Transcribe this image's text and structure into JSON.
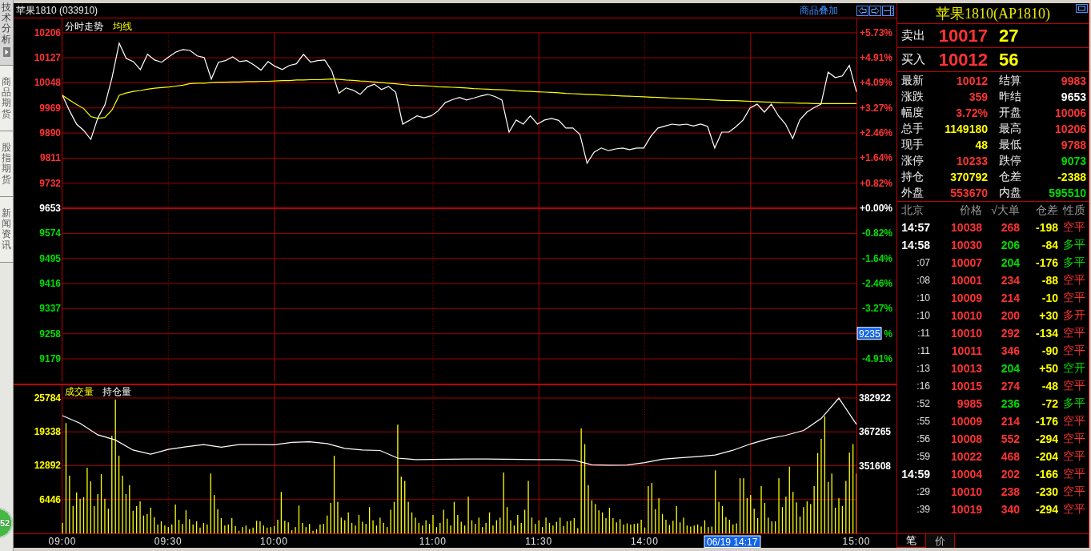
{
  "side_tabs": [
    {
      "label": "技术分析",
      "selected": true
    },
    {
      "label": "商品期货",
      "selected": false
    },
    {
      "label": "股指期货",
      "selected": false
    },
    {
      "label": "新闻资讯",
      "selected": false
    }
  ],
  "header": {
    "title": "苹果1810 (033910)",
    "overlay_link": "商品叠加"
  },
  "price_panel": {
    "chart_data": {
      "type": "line",
      "categories": [
        null,
        null,
        null,
        null,
        null,
        null,
        null,
        null,
        null,
        null,
        null,
        null,
        null,
        null,
        null,
        null,
        null,
        null,
        null,
        null,
        null,
        null,
        null,
        null,
        null,
        null,
        null,
        null,
        null,
        null,
        null,
        null,
        null,
        null,
        null,
        null,
        null,
        null,
        null,
        null,
        null,
        null,
        null,
        null,
        null,
        null,
        null,
        null,
        null,
        null,
        null,
        null,
        null,
        null,
        null,
        null,
        null,
        null,
        null,
        null,
        null,
        null,
        null,
        null,
        null,
        null,
        null,
        null,
        null,
        null,
        null,
        null,
        null,
        null,
        null,
        null,
        null,
        null,
        null,
        null,
        null,
        null,
        null,
        null,
        null,
        null,
        null,
        null,
        null,
        null,
        null,
        null,
        null,
        null,
        null,
        null,
        null,
        null,
        null,
        null,
        null,
        null,
        null,
        null,
        null,
        null,
        null,
        null,
        null,
        null,
        null,
        null,
        null
      ],
      "series": [
        {
          "name": "分时走势",
          "color": "#ffffff",
          "values": [
            10009,
            9960,
            9918,
            9898,
            9870,
            9938,
            9979,
            10065,
            10173,
            10125,
            10115,
            10090,
            10138,
            10120,
            10113,
            10130,
            10145,
            10153,
            10150,
            10133,
            10128,
            10060,
            10113,
            10118,
            10130,
            10115,
            10118,
            10105,
            10088,
            10115,
            10100,
            10090,
            10103,
            10108,
            10138,
            10113,
            10118,
            10120,
            10085,
            10015,
            10032,
            10025,
            10012,
            10035,
            10044,
            10027,
            10037,
            10019,
            9918,
            9931,
            9944,
            9938,
            9944,
            9960,
            9986,
            9995,
            10002,
            9994,
            10000,
            10007,
            10012,
            10005,
            9994,
            9893,
            9931,
            9918,
            9944,
            9918,
            9931,
            9936,
            9930,
            9906,
            9906,
            9885,
            9795,
            9830,
            9843,
            9835,
            9840,
            9843,
            9838,
            9843,
            9843,
            9880,
            9906,
            9912,
            9918,
            9915,
            9918,
            9912,
            9918,
            9911,
            9843,
            9893,
            9893,
            9910,
            9931,
            9969,
            9981,
            9956,
            9981,
            9944,
            9918,
            9873,
            9931,
            9956,
            9970,
            9981,
            10082,
            10065,
            10070,
            10103,
            10020
          ]
        },
        {
          "name": "均线",
          "color": "#ffff00",
          "values": [
            10009,
            9994,
            9980,
            9967,
            9942,
            9936,
            9939,
            9963,
            10009,
            10016,
            10021,
            10024,
            10028,
            10031,
            10033,
            10035,
            10038,
            10041,
            10046,
            10047,
            10047,
            10049,
            10050,
            10050,
            10051,
            10051,
            10052,
            10052,
            10053,
            10053,
            10054,
            10055,
            10055,
            10057,
            10057,
            10058,
            10058,
            10059,
            10060,
            10059,
            10057,
            10056,
            10054,
            10053,
            10051,
            10049,
            10047,
            10045,
            10043,
            10041,
            10040,
            10039,
            10038,
            10036,
            10035,
            10034,
            10033,
            10032,
            10030,
            10029,
            10028,
            10027,
            10026,
            10025,
            10023,
            10022,
            10021,
            10020,
            10019,
            10018,
            10017,
            10015,
            10014,
            10013,
            10012,
            10011,
            10010,
            10009,
            10008,
            10007,
            10006,
            10005,
            10004,
            10003,
            10002,
            10001,
            10000,
            9999,
            9998,
            9997,
            9996,
            9995,
            9994,
            9993,
            9992,
            9992,
            9991,
            9990,
            9989,
            9988,
            9987,
            9986,
            9985,
            9985,
            9984,
            9984,
            9983,
            9983,
            9983,
            9983,
            9983,
            9983,
            9983
          ]
        }
      ],
      "ylim": [
        9101,
        10251
      ],
      "yticks": [
        10206,
        10127,
        10048,
        9969,
        9890,
        9811,
        9732,
        9653,
        9574,
        9495,
        9416,
        9337,
        9258,
        9179
      ],
      "ref_lines": [
        {
          "axis": "y",
          "value": 9653
        }
      ],
      "grid": true
    },
    "percent_labels": [
      {
        "text": "+5.73%"
      },
      {
        "text": "+4.91%"
      },
      {
        "text": "+4.09%"
      },
      {
        "text": "+3.27%"
      },
      {
        "text": "+2.46%"
      },
      {
        "text": "+1.64%"
      },
      {
        "text": "+0.82%"
      },
      {
        "text": "+0.00%"
      },
      {
        "text": "-0.82%"
      },
      {
        "text": "-1.64%"
      },
      {
        "text": "-2.46%"
      },
      {
        "text": "-3.27%"
      },
      {
        "text": "%",
        "cursor": "9235"
      },
      {
        "text": "-4.91%"
      }
    ]
  },
  "volume_panel": {
    "chart_data": {
      "type": "bar",
      "categories": [
        "09:00",
        null,
        null,
        null,
        null,
        null,
        null,
        null,
        null,
        null,
        null,
        null,
        null,
        null,
        null,
        null,
        null,
        null,
        null,
        null,
        null,
        null,
        null,
        null,
        null,
        null,
        null,
        null,
        null,
        null,
        "09:30",
        null,
        null,
        null,
        null,
        null,
        null,
        null,
        null,
        null,
        null,
        null,
        null,
        null,
        null,
        null,
        null,
        null,
        null,
        null,
        null,
        null,
        null,
        null,
        null,
        null,
        null,
        null,
        null,
        null,
        "10:00",
        null,
        null,
        null,
        null,
        null,
        null,
        null,
        null,
        null,
        null,
        null,
        null,
        null,
        null,
        null,
        null,
        null,
        null,
        null,
        null,
        null,
        null,
        null,
        null,
        null,
        null,
        null,
        null,
        null,
        null,
        null,
        null,
        null,
        null,
        null,
        null,
        null,
        null,
        null,
        null,
        null,
        null,
        null,
        null,
        "11:00",
        null,
        null,
        null,
        null,
        null,
        null,
        null,
        null,
        null,
        null,
        null,
        null,
        null,
        null,
        null,
        null,
        null,
        null,
        null,
        null,
        null,
        null,
        null,
        null,
        null,
        null,
        null,
        null,
        null,
        "11:30",
        null,
        null,
        null,
        null,
        null,
        null,
        null,
        null,
        null,
        null,
        null,
        null,
        null,
        null,
        null,
        null,
        null,
        null,
        null,
        null,
        null,
        null,
        null,
        null,
        null,
        null,
        null,
        null,
        null,
        "14:00",
        null,
        null,
        null,
        null,
        null,
        null,
        null,
        null,
        null,
        null,
        null,
        null,
        null,
        null,
        null,
        null,
        null,
        null,
        null,
        null,
        null,
        null,
        null,
        null,
        null,
        null,
        null,
        null,
        null,
        null,
        null,
        null,
        null,
        null,
        null,
        null,
        null,
        null,
        null,
        null,
        null,
        null,
        null,
        null,
        null,
        null,
        null,
        null,
        null,
        null,
        null,
        null,
        null,
        null,
        null,
        null,
        null,
        null,
        null,
        "15:00"
      ],
      "series": [
        {
          "name": "成交量",
          "color": "#ffff00",
          "values": [
            2000,
            21000,
            11000,
            5200,
            7800,
            6600,
            6900,
            12500,
            9900,
            5200,
            7500,
            11300,
            6600,
            4700,
            18600,
            25500,
            14800,
            11000,
            7500,
            9200,
            4300,
            5200,
            6100,
            3400,
            3700,
            4900,
            3100,
            1700,
            2300,
            1500,
            1200,
            1700,
            5500,
            2600,
            1800,
            4400,
            2700,
            1700,
            2300,
            1100,
            2000,
            1700,
            11400,
            7300,
            4600,
            2900,
            1500,
            1700,
            2900,
            1400,
            500,
            1200,
            1500,
            800,
            1100,
            2400,
            2300,
            1500,
            1100,
            1200,
            1400,
            2600,
            7900,
            2400,
            2100,
            600,
            1200,
            5300,
            2000,
            1200,
            1800,
            500,
            800,
            1700,
            1800,
            3400,
            5800,
            14800,
            6000,
            3000,
            2500,
            4000,
            2000,
            1500,
            3500,
            2200,
            1800,
            5000,
            2500,
            1500,
            3000,
            2000,
            1200,
            4500,
            6000,
            20700,
            10800,
            10000,
            6000,
            4000,
            3000,
            2000,
            1500,
            2500,
            1800,
            3500,
            1200,
            2000,
            4500,
            2800,
            1500,
            6000,
            3500,
            2200,
            1500,
            7000,
            2500,
            1800,
            3000,
            1200,
            2000,
            4000,
            1500,
            2500,
            3000,
            11600,
            5000,
            2500,
            1500,
            3500,
            2000,
            4500,
            10000,
            3000,
            1800,
            2500,
            1200,
            3000,
            2000,
            1500,
            2200,
            3000,
            1400,
            2300,
            2400,
            2900,
            1000,
            20000,
            17000,
            9200,
            6300,
            5600,
            4400,
            4000,
            2900,
            4900,
            2900,
            2100,
            2700,
            1700,
            1900,
            1700,
            1800,
            1900,
            2600,
            1100,
            9000,
            9600,
            4600,
            6700,
            3700,
            2600,
            1600,
            2400,
            5200,
            2100,
            3000,
            1500,
            1300,
            1500,
            1700,
            1300,
            2500,
            1200,
            1300,
            12000,
            6000,
            5200,
            3100,
            2600,
            1700,
            1900,
            10500,
            10500,
            6700,
            7300,
            4700,
            2900,
            9000,
            5800,
            3000,
            2300,
            2300,
            10500,
            5000,
            7000,
            12700,
            7900,
            5900,
            3200,
            5000,
            6100,
            5600,
            9000,
            15300,
            18000,
            22300,
            9800,
            11400,
            4900,
            6700,
            5200,
            10000,
            15400,
            17000,
            11400
          ]
        }
      ],
      "ylim": [
        0,
        28221
      ],
      "yticks": [
        6446,
        12892,
        19338,
        25784
      ],
      "grid": true
    },
    "cursor_label": "06/19 14:17"
  },
  "open_interest_overlay": {
    "chart_data": {
      "type": "line",
      "categories": [
        null,
        null,
        null,
        null,
        null,
        null,
        null,
        null,
        null,
        null,
        null,
        null,
        null,
        null,
        null,
        null,
        null,
        null,
        null,
        null,
        null,
        null,
        null,
        null,
        null,
        null,
        null,
        null,
        null,
        null,
        null,
        null,
        null,
        null,
        null,
        null,
        null,
        null,
        null,
        null,
        null,
        null,
        null,
        null,
        null,
        null
      ],
      "series": [
        {
          "name": "持仓量",
          "color": "#ffffff",
          "values": [
            374800,
            371300,
            366000,
            363600,
            359000,
            357100,
            359300,
            360500,
            361500,
            360300,
            361500,
            361500,
            361400,
            362500,
            362800,
            362000,
            359800,
            359000,
            358800,
            355300,
            354600,
            354700,
            354800,
            354900,
            354900,
            354800,
            354700,
            354600,
            354600,
            354300,
            352200,
            352000,
            352100,
            353200,
            354800,
            355400,
            356000,
            356700,
            358900,
            361800,
            364200,
            365800,
            368000,
            373500,
            382900,
            370800
          ]
        }
      ],
      "ylim": [
        320660,
        388816
      ],
      "yticks": [
        351608,
        367265,
        382922
      ]
    }
  },
  "quote_panel": {
    "title": "苹果1810(AP1810)",
    "depth": [
      {
        "label": "卖出",
        "price": "10017",
        "volume": "27"
      },
      {
        "label": "买入",
        "price": "10012",
        "volume": "56"
      }
    ],
    "stats": [
      {
        "label": "最新",
        "value": "10012",
        "color": "#ff3333"
      },
      {
        "label": "结算",
        "value": "9983",
        "color": "#ff3333"
      },
      {
        "label": "涨跌",
        "value": "359",
        "color": "#ff3333"
      },
      {
        "label": "昨结",
        "value": "9653",
        "color": "#ffffff"
      },
      {
        "label": "幅度",
        "value": "3.72%",
        "color": "#ff3333"
      },
      {
        "label": "开盘",
        "value": "10006",
        "color": "#ff3333"
      },
      {
        "label": "总手",
        "value": "1149180",
        "color": "#ffff00"
      },
      {
        "label": "最高",
        "value": "10206",
        "color": "#ff3333"
      },
      {
        "label": "现手",
        "value": "48",
        "color": "#ffff00"
      },
      {
        "label": "最低",
        "value": "9788",
        "color": "#ff3333"
      },
      {
        "label": "涨停",
        "value": "10233",
        "color": "#ff3333"
      },
      {
        "label": "跌停",
        "value": "9073",
        "color": "#00dd00"
      },
      {
        "label": "持仓",
        "value": "370792",
        "color": "#ffff00"
      },
      {
        "label": "仓差",
        "value": "-2388",
        "color": "#ffff00"
      },
      {
        "label": "外盘",
        "value": "553670",
        "color": "#ff3333"
      },
      {
        "label": "内盘",
        "value": "595510",
        "color": "#00dd00"
      }
    ]
  },
  "trades": {
    "columns": [
      "北京",
      "价格",
      "√大单",
      "仓差",
      "性质"
    ],
    "rows": [
      {
        "time": "14:57",
        "kind": "minute",
        "price": "10038",
        "volume": "268",
        "change": "-198",
        "type": "空平",
        "color": "#ff3333"
      },
      {
        "time": "14:58",
        "kind": "minute",
        "price": "10030",
        "volume": "206",
        "change": "-84",
        "type": "多平",
        "color": "#00dd00"
      },
      {
        "time": ":07",
        "kind": "second",
        "price": "10007",
        "volume": "204",
        "change": "-176",
        "type": "多平",
        "color": "#00dd00"
      },
      {
        "time": ":08",
        "kind": "second",
        "price": "10001",
        "volume": "234",
        "change": "-88",
        "type": "空平",
        "color": "#ff3333"
      },
      {
        "time": ":10",
        "kind": "second",
        "price": "10009",
        "volume": "214",
        "change": "-10",
        "type": "空平",
        "color": "#ff3333"
      },
      {
        "time": ":10",
        "kind": "second",
        "price": "10010",
        "volume": "200",
        "change": "+30",
        "type": "多开",
        "color": "#ff3333"
      },
      {
        "time": ":11",
        "kind": "second",
        "price": "10010",
        "volume": "292",
        "change": "-134",
        "type": "空平",
        "color": "#ff3333"
      },
      {
        "time": ":11",
        "kind": "second",
        "price": "10011",
        "volume": "346",
        "change": "-90",
        "type": "空平",
        "color": "#ff3333"
      },
      {
        "time": ":13",
        "kind": "second",
        "price": "10013",
        "volume": "204",
        "change": "+50",
        "type": "空开",
        "color": "#00dd00"
      },
      {
        "time": ":16",
        "kind": "second",
        "price": "10015",
        "volume": "274",
        "change": "-48",
        "type": "空平",
        "color": "#ff3333"
      },
      {
        "time": ":52",
        "kind": "second",
        "price": "9985",
        "volume": "236",
        "change": "-72",
        "type": "多平",
        "color": "#00dd00"
      },
      {
        "time": ":55",
        "kind": "second",
        "price": "10009",
        "volume": "214",
        "change": "-176",
        "type": "空平",
        "color": "#ff3333"
      },
      {
        "time": ":56",
        "kind": "second",
        "price": "10008",
        "volume": "552",
        "change": "-294",
        "type": "空平",
        "color": "#ff3333"
      },
      {
        "time": ":59",
        "kind": "second",
        "price": "10022",
        "volume": "468",
        "change": "-204",
        "type": "空平",
        "color": "#ff3333"
      },
      {
        "time": "14:59",
        "kind": "minute",
        "price": "10004",
        "volume": "202",
        "change": "-166",
        "type": "空平",
        "color": "#ff3333"
      },
      {
        "time": ":29",
        "kind": "second",
        "price": "10010",
        "volume": "238",
        "change": "-230",
        "type": "空平",
        "color": "#ff3333"
      },
      {
        "time": ":39",
        "kind": "second",
        "price": "10019",
        "volume": "340",
        "change": "-294",
        "type": "空平",
        "color": "#ff3333"
      }
    ]
  },
  "list_tabs": [
    {
      "label": "笔",
      "selected": true
    },
    {
      "label": "价",
      "selected": false
    }
  ],
  "floating_ball": {
    "text": "52"
  }
}
